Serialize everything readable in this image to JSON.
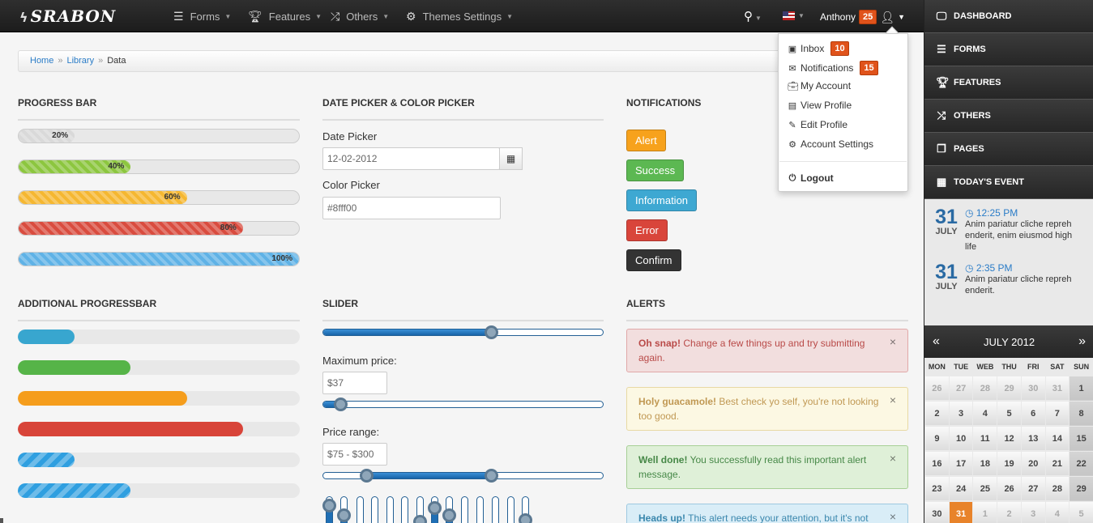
{
  "brand": {
    "logo": "SRABON"
  },
  "nav": {
    "items": [
      {
        "label": "Forms",
        "icon": "list-icon"
      },
      {
        "label": "Features",
        "icon": "trophy-icon"
      },
      {
        "label": "Others",
        "icon": "shuffle-icon"
      },
      {
        "label": "Themes Settings",
        "icon": "gear-icon"
      }
    ]
  },
  "user": {
    "name": "Anthony",
    "badge": "25"
  },
  "dropdown": {
    "items": [
      {
        "label": "Inbox",
        "icon": "inbox-icon",
        "badge": "10"
      },
      {
        "label": "Notifications",
        "icon": "envelope-icon",
        "badge": "15"
      },
      {
        "label": "My Account",
        "icon": "briefcase-icon"
      },
      {
        "label": "View Profile",
        "icon": "file-icon"
      },
      {
        "label": "Edit Profile",
        "icon": "pencil-icon"
      },
      {
        "label": "Account Settings",
        "icon": "gear-icon"
      }
    ],
    "logout": "Logout"
  },
  "sidebar": {
    "items": [
      {
        "label": "DASHBOARD",
        "icon": "monitor-icon"
      },
      {
        "label": "FORMS",
        "icon": "list-icon"
      },
      {
        "label": "FEATURES",
        "icon": "trophy-icon"
      },
      {
        "label": "OTHERS",
        "icon": "shuffle-icon"
      },
      {
        "label": "PAGES",
        "icon": "pages-icon"
      },
      {
        "label": "TODAY'S EVENT",
        "icon": "calendar-icon"
      }
    ]
  },
  "events": [
    {
      "day": "31",
      "month": "JULY",
      "time": "12:25 PM",
      "text": "Anim pariatur cliche repreh enderit, enim eiusmod high life"
    },
    {
      "day": "31",
      "month": "JULY",
      "time": "2:35 PM",
      "text": "Anim pariatur cliche repreh enderit."
    }
  ],
  "calendar": {
    "prev": "«",
    "title": "JULY 2012",
    "next": "»",
    "days": [
      "MON",
      "TUE",
      "WEB",
      "THU",
      "FRI",
      "SAT",
      "SUN"
    ],
    "weeks": [
      [
        "26",
        "27",
        "28",
        "29",
        "30",
        "31",
        "1"
      ],
      [
        "2",
        "3",
        "4",
        "5",
        "6",
        "7",
        "8"
      ],
      [
        "9",
        "10",
        "11",
        "12",
        "13",
        "14",
        "15"
      ],
      [
        "16",
        "17",
        "18",
        "19",
        "20",
        "21",
        "22"
      ],
      [
        "23",
        "24",
        "25",
        "26",
        "27",
        "28",
        "29"
      ],
      [
        "30",
        "31",
        "1",
        "2",
        "3",
        "4",
        "5"
      ]
    ]
  },
  "breadcrumb": {
    "items": [
      "Home",
      "Library",
      "Data"
    ],
    "sep": "»"
  },
  "progress": {
    "title": "PROGRESS BAR",
    "bars": [
      {
        "pct": 20,
        "label": "20%",
        "color": "#d9d9d9"
      },
      {
        "pct": 40,
        "label": "40%",
        "color": "#8cc63f"
      },
      {
        "pct": 60,
        "label": "60%",
        "color": "#f5b731"
      },
      {
        "pct": 80,
        "label": "80%",
        "color": "#d94c3f"
      },
      {
        "pct": 100,
        "label": "100%",
        "color": "#5fb2e6"
      }
    ]
  },
  "additional": {
    "title": "ADDITIONAL PROGRESSBAR",
    "bars": [
      {
        "pct": 20,
        "color": "#38a6cf"
      },
      {
        "pct": 40,
        "color": "#56b448"
      },
      {
        "pct": 60,
        "color": "#f59d1c"
      },
      {
        "pct": 80,
        "color": "#d84439"
      },
      {
        "pct": 20,
        "color": "#2f9fe0",
        "striped": true
      },
      {
        "pct": 40,
        "color": "#2f9fe0",
        "striped": true
      }
    ]
  },
  "pickers": {
    "title": "DATE PICKER & COLOR PICKER",
    "date_label": "Date Picker",
    "date_value": "12-02-2012",
    "color_label": "Color Picker",
    "color_value": "#8fff00"
  },
  "slider": {
    "title": "SLIDER",
    "max_label": "Maximum price:",
    "max_value": "$37",
    "range_label": "Price range:",
    "range_value": "$75 - $300",
    "main_value": 0.6,
    "max_pos": 0.06,
    "range": [
      0.155,
      0.6
    ]
  },
  "notifications": {
    "title": "NOTIFICATIONS",
    "buttons": [
      {
        "label": "Alert",
        "color": "#f7a21c"
      },
      {
        "label": "Success",
        "color": "#5cb852"
      },
      {
        "label": "Information",
        "color": "#3ea8d2"
      },
      {
        "label": "Error",
        "color": "#d9453b"
      },
      {
        "label": "Confirm",
        "color": "#333333"
      }
    ]
  },
  "alerts": {
    "title": "ALERTS",
    "items": [
      {
        "strong": "Oh snap!",
        "text": " Change a few things up and try submitting again.",
        "bg": "#f2dede",
        "border": "#e1a8a8",
        "color": "#b94a48"
      },
      {
        "strong": "Holy guacamole!",
        "text": " Best check yo self, you're not looking too good.",
        "bg": "#fcf8e3",
        "border": "#e8d9a3",
        "color": "#c09853"
      },
      {
        "strong": "Well done!",
        "text": " You successfully read this important alert message.",
        "bg": "#dff0d8",
        "border": "#a7cf96",
        "color": "#468847"
      },
      {
        "strong": "Heads up!",
        "text": " This alert needs your attention, but it's not",
        "bg": "#d9edf7",
        "border": "#9ec9e0",
        "color": "#3a87ad"
      }
    ]
  }
}
